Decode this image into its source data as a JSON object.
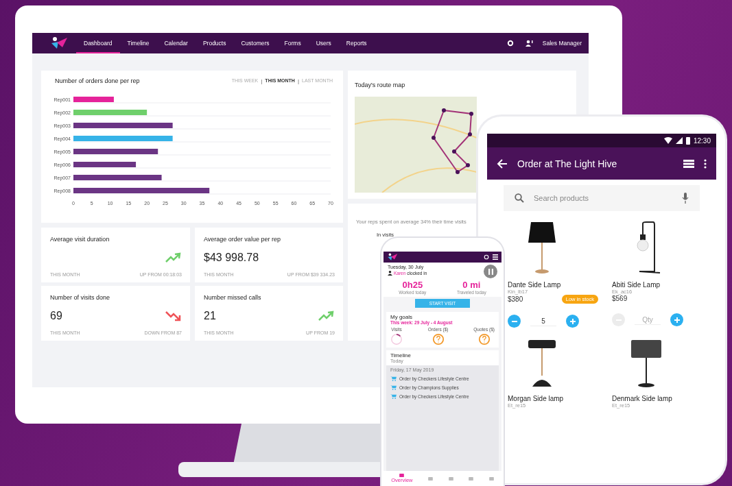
{
  "desktop": {
    "nav": {
      "tabs": [
        {
          "label": "Dashboard",
          "selected": true
        },
        {
          "label": "Timeline",
          "selected": false
        },
        {
          "label": "Calendar",
          "selected": false
        },
        {
          "label": "Products",
          "selected": false
        },
        {
          "label": "Customers",
          "selected": false
        },
        {
          "label": "Forms",
          "selected": false
        },
        {
          "label": "Users",
          "selected": false
        },
        {
          "label": "Reports",
          "selected": false
        }
      ],
      "user": "Sales Manager"
    },
    "orders_card": {
      "title": "Number of orders done per rep",
      "separator": "|",
      "periods": [
        {
          "label": "THIS WEEK",
          "selected": false
        },
        {
          "label": "THIS MONTH",
          "selected": true
        },
        {
          "label": "LAST MONTH",
          "selected": false
        }
      ],
      "chart_data": {
        "type": "bar",
        "orientation": "horizontal",
        "categories": [
          "Rep001",
          "Rep002",
          "Rep003",
          "Rep004",
          "Rep005",
          "Rep006",
          "Rep007",
          "Rep008"
        ],
        "xlim": [
          0,
          70
        ],
        "xticks": [
          0,
          5,
          10,
          15,
          20,
          25,
          30,
          35,
          40,
          45,
          50,
          55,
          60,
          65,
          70
        ],
        "series": [
          {
            "color": "#e5239a",
            "values": [
              11,
              null,
              null,
              null,
              null,
              null,
              null,
              null
            ]
          },
          {
            "color": "#6fcf6b",
            "values": [
              null,
              20,
              null,
              null,
              null,
              null,
              null,
              null
            ]
          },
          {
            "color": "#6b3584",
            "values": [
              null,
              null,
              27,
              null,
              23,
              17,
              24,
              37
            ]
          },
          {
            "color": "#36b3e8",
            "values": [
              null,
              null,
              null,
              27,
              null,
              null,
              null,
              null
            ]
          }
        ]
      }
    },
    "stats": [
      {
        "title": "Average visit duration",
        "kind": "rising",
        "period": "THIS MONTH",
        "compare": "UP FROM 00:18:03"
      },
      {
        "title": "Average order value per rep",
        "value": "$43 998.78",
        "period": "THIS MONTH",
        "compare": "UP FROM $39 334.23"
      },
      {
        "title": "Number of visits done",
        "value": "69",
        "kind": "falling",
        "period": "THIS MONTH",
        "compare": "DOWN FROM 87"
      },
      {
        "title": "Number missed calls",
        "value": "21",
        "kind": "rising",
        "period": "THIS MONTH",
        "compare": "UP FROM 19"
      }
    ],
    "map_card": {
      "title": "Today's route map"
    },
    "time_card": {
      "text": "Your reps spent on average 34% their time visits",
      "legend": "In visits"
    }
  },
  "tablet": {
    "time": "12:30",
    "title": "Order at The Light Hive",
    "search": {
      "placeholder": "Search products"
    },
    "products": [
      {
        "name": "Dante Side Lamp",
        "code": "Kin_lb17",
        "price": "$380",
        "badge": "Low in stock",
        "qty": "5",
        "kind": "shade"
      },
      {
        "name": "Abiti Side Lamp",
        "code": "Ek_ac16",
        "price": "$569",
        "qty_placeholder": "Qty",
        "kind": "bulb"
      },
      {
        "name": "Morgan Side lamp",
        "code": "Et_re15",
        "kind": "banker"
      },
      {
        "name": "Denmark Side lamp",
        "code": "Et_re15",
        "kind": "mesh"
      }
    ]
  },
  "phone": {
    "date": "Tuesday, 30 July",
    "user": "Karen",
    "clock_text": "clocked in",
    "metrics": [
      {
        "value": "0h25",
        "label": "Worked today"
      },
      {
        "value": "0 mi",
        "label": "Traveled today"
      }
    ],
    "start_button": "START VISIT",
    "goals": {
      "title": "My goals",
      "week": "This week: 29 July - 4 August",
      "items": [
        {
          "label": "Visits",
          "kind": "progress"
        },
        {
          "label": "Orders ($)",
          "kind": "unknown"
        },
        {
          "label": "Quotes ($)",
          "kind": "unknown"
        }
      ]
    },
    "timeline": {
      "title": "Timeline",
      "subtitle": "Today",
      "date": "Friday, 17 May 2019",
      "entries": [
        "Order by Checkers Lifestyle Centre",
        "Order by Champions Supplies",
        "Order by Checkers Lifestyle Centre"
      ]
    },
    "nav": [
      {
        "label": "Overview",
        "selected": true
      },
      {
        "selected": false
      },
      {
        "selected": false
      },
      {
        "selected": false
      },
      {
        "selected": false
      }
    ]
  }
}
